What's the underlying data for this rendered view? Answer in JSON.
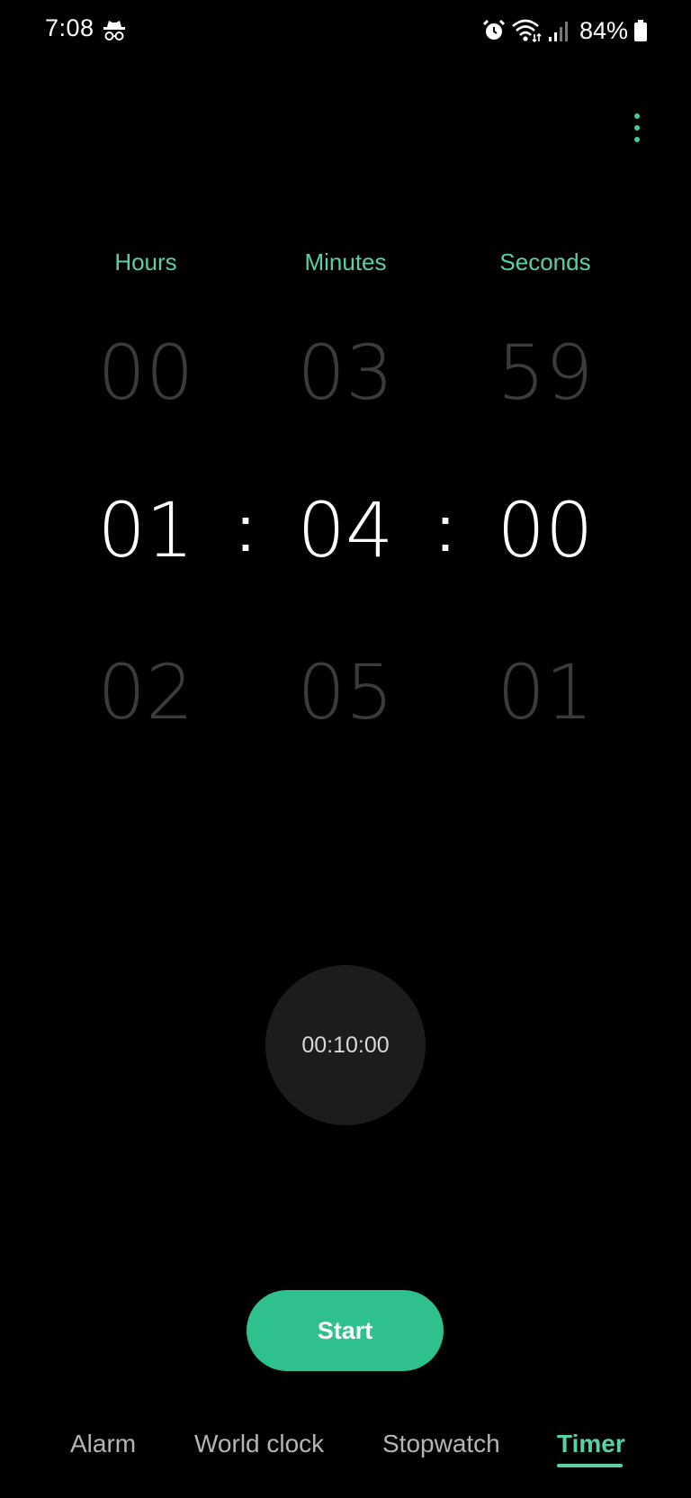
{
  "status_bar": {
    "time": "7:08",
    "battery": "84%",
    "icons": [
      "incognito-icon",
      "alarm-icon",
      "wifi-icon",
      "signal-icon",
      "battery-icon"
    ]
  },
  "menu": {
    "icon": "more-vert-icon"
  },
  "picker": {
    "labels": {
      "hours": "Hours",
      "minutes": "Minutes",
      "seconds": "Seconds"
    },
    "hours": {
      "prev": "00",
      "current": "01",
      "next": "02"
    },
    "minutes": {
      "prev": "03",
      "current": "04",
      "next": "05"
    },
    "seconds": {
      "prev": "59",
      "current": "00",
      "next": "01"
    },
    "separator": ":"
  },
  "preset": {
    "label": "00:10:00"
  },
  "start_button": {
    "label": "Start"
  },
  "tabs": [
    {
      "label": "Alarm",
      "active": false
    },
    {
      "label": "World clock",
      "active": false
    },
    {
      "label": "Stopwatch",
      "active": false
    },
    {
      "label": "Timer",
      "active": true
    }
  ],
  "colors": {
    "accent": "#58d1a6",
    "button": "#2ec18d",
    "background": "#000000"
  }
}
